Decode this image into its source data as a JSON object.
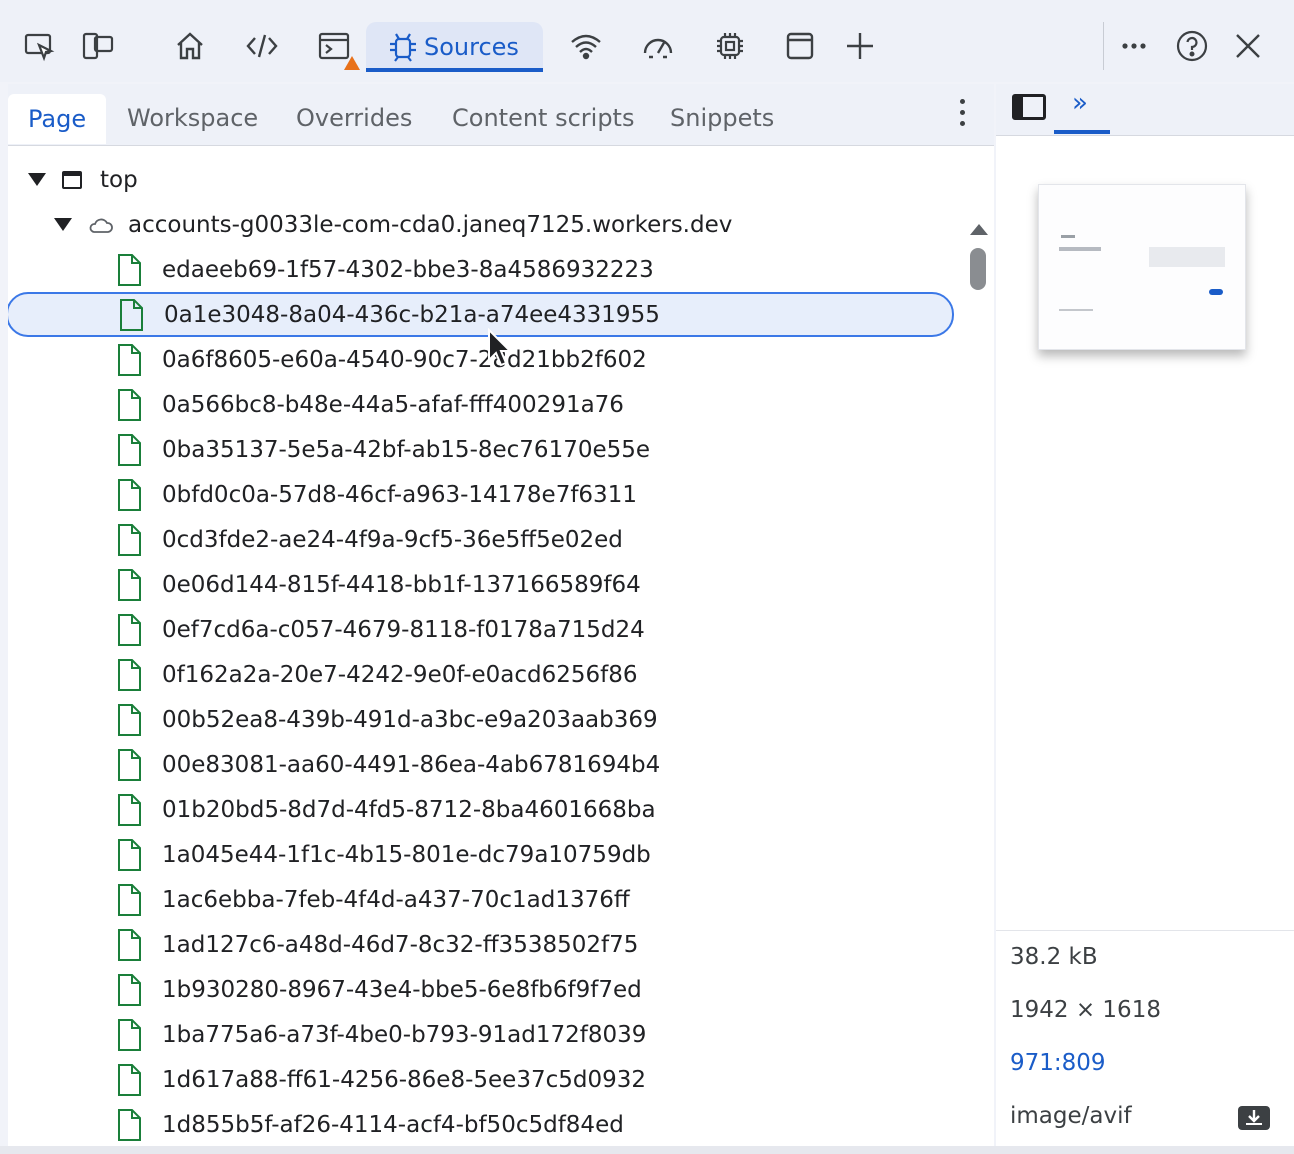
{
  "toolbar": {
    "sources_label": "Sources",
    "icons": [
      "inspect-icon",
      "device-toggle-icon",
      "home-icon",
      "elements-icon",
      "console-icon",
      "sources-icon",
      "network-icon",
      "performance-icon",
      "memory-icon",
      "application-icon",
      "add-tool-icon",
      "more-icon",
      "help-icon",
      "close-icon"
    ],
    "accent": "#1a5cc8",
    "warning_color": "#e8711a"
  },
  "subtabs": [
    {
      "label": "Page",
      "active": true
    },
    {
      "label": "Workspace",
      "active": false
    },
    {
      "label": "Overrides",
      "active": false
    },
    {
      "label": "Content scripts",
      "active": false
    },
    {
      "label": "Snippets",
      "active": false
    }
  ],
  "tree": {
    "root_label": "top",
    "domain_label": "accounts-g0033le-com-cda0.janeq7125.workers.dev",
    "selected_index": 1,
    "files": [
      "edaeeb69-1f57-4302-bbe3-8a4586932223",
      "0a1e3048-8a04-436c-b21a-a74ee4331955",
      "0a6f8605-e60a-4540-90c7-28d21bb2f602",
      "0a566bc8-b48e-44a5-afaf-fff400291a76",
      "0ba35137-5e5a-42bf-ab15-8ec76170e55e",
      "0bfd0c0a-57d8-46cf-a963-14178e7f6311",
      "0cd3fde2-ae24-4f9a-9cf5-36e5ff5e02ed",
      "0e06d144-815f-4418-bb1f-137166589f64",
      "0ef7cd6a-c057-4679-8118-f0178a715d24",
      "0f162a2a-20e7-4242-9e0f-e0acd6256f86",
      "00b52ea8-439b-491d-a3bc-e9a203aab369",
      "00e83081-aa60-4491-86ea-4ab6781694b4",
      "01b20bd5-8d7d-4fd5-8712-8ba4601668ba",
      "1a045e44-1f1c-4b15-801e-dc79a10759db",
      "1ac6ebba-7feb-4f4d-a437-70c1ad1376ff",
      "1ad127c6-a48d-46d7-8c32-ff3538502f75",
      "1b930280-8967-43e4-bbe5-6e8fb6f9f7ed",
      "1ba775a6-a73f-4be0-b793-91ad172f8039",
      "1d617a88-ff61-4256-86e8-5ee37c5d0932",
      "1d855b5f-af26-4114-acf4-bf50c5df84ed"
    ]
  },
  "preview": {
    "size": "38.2 kB",
    "dimensions": "1942 × 1618",
    "ratio": "971:809",
    "mime": "image/avif"
  }
}
